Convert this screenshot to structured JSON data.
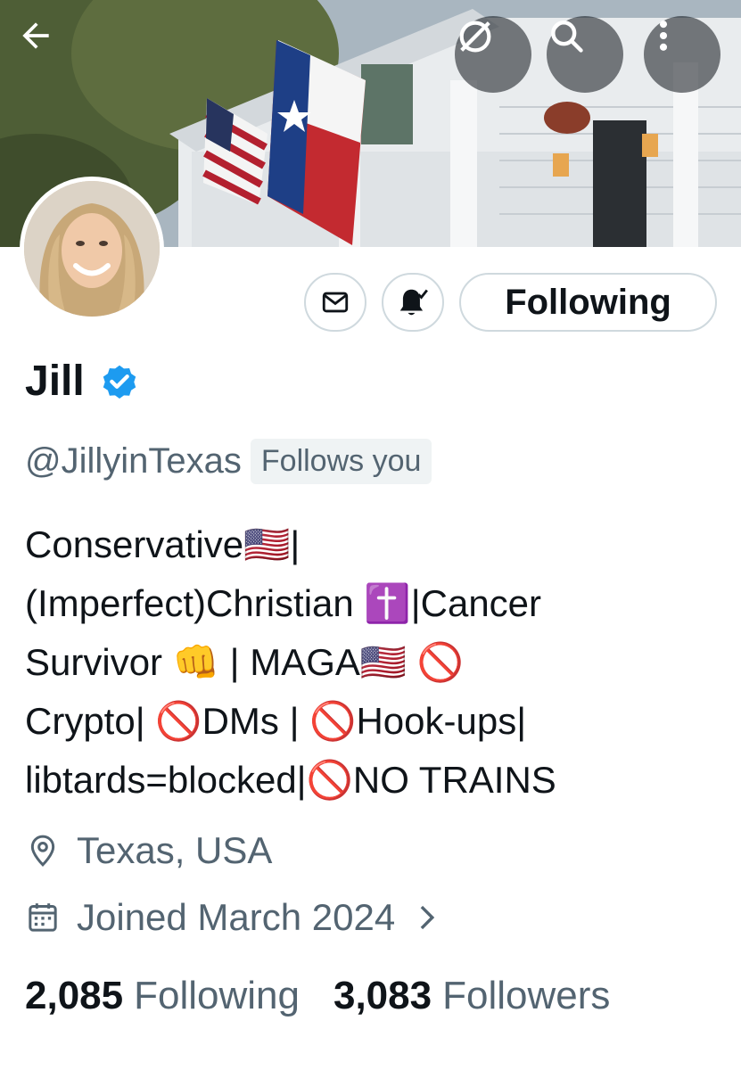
{
  "profile": {
    "name": "Jill",
    "handle": "@JillyinTexas",
    "follows_you": "Follows you",
    "verified": true,
    "bio": "Conservative🇺🇸|\n(Imperfect)Christian ✝️|Cancer\nSurvivor 👊 | MAGA🇺🇸 🚫\nCrypto| 🚫DMs | 🚫Hook-ups|\nlibtards=blocked|🚫NO TRAINS",
    "location": "Texas, USA",
    "joined": "Joined March 2024"
  },
  "actions": {
    "follow_label": "Following",
    "message_icon": "mail-icon",
    "notify_icon": "bell-check-icon"
  },
  "stats": {
    "following_count": "2,085",
    "following_label": "Following",
    "followers_count": "3,083",
    "followers_label": "Followers"
  },
  "header": {
    "back_icon": "back-arrow-icon",
    "grok_icon": "grok-icon",
    "search_icon": "search-icon",
    "more_icon": "more-vertical-icon"
  },
  "colors": {
    "verified_blue": "#1d9bf0",
    "secondary_text": "#536471",
    "primary_text": "#0f1419"
  }
}
